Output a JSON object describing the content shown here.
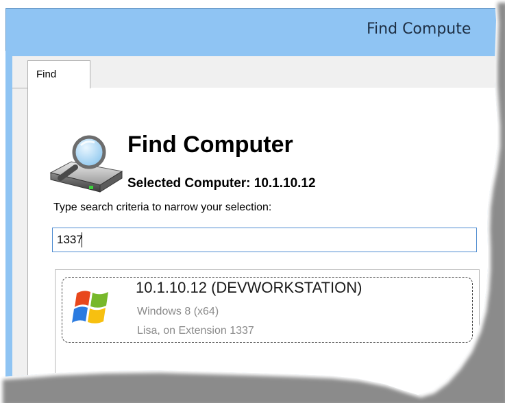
{
  "window": {
    "title": "Find Compute"
  },
  "tabs": [
    {
      "label": "Find"
    }
  ],
  "header": {
    "title": "Find Computer",
    "selected_label": "Selected Computer: 10.1.10.12"
  },
  "search": {
    "label": "Type search criteria to narrow your selection:",
    "value": "1337"
  },
  "results": [
    {
      "title": "10.1.10.12 (DEVWORKSTATION)",
      "os": "Windows 8 (x64)",
      "user": "Lisa, on Extension 1337",
      "icon": "windows-logo-icon"
    }
  ],
  "colors": {
    "titlebar": "#8fc4f3",
    "border_accent": "#4d8bd0"
  }
}
